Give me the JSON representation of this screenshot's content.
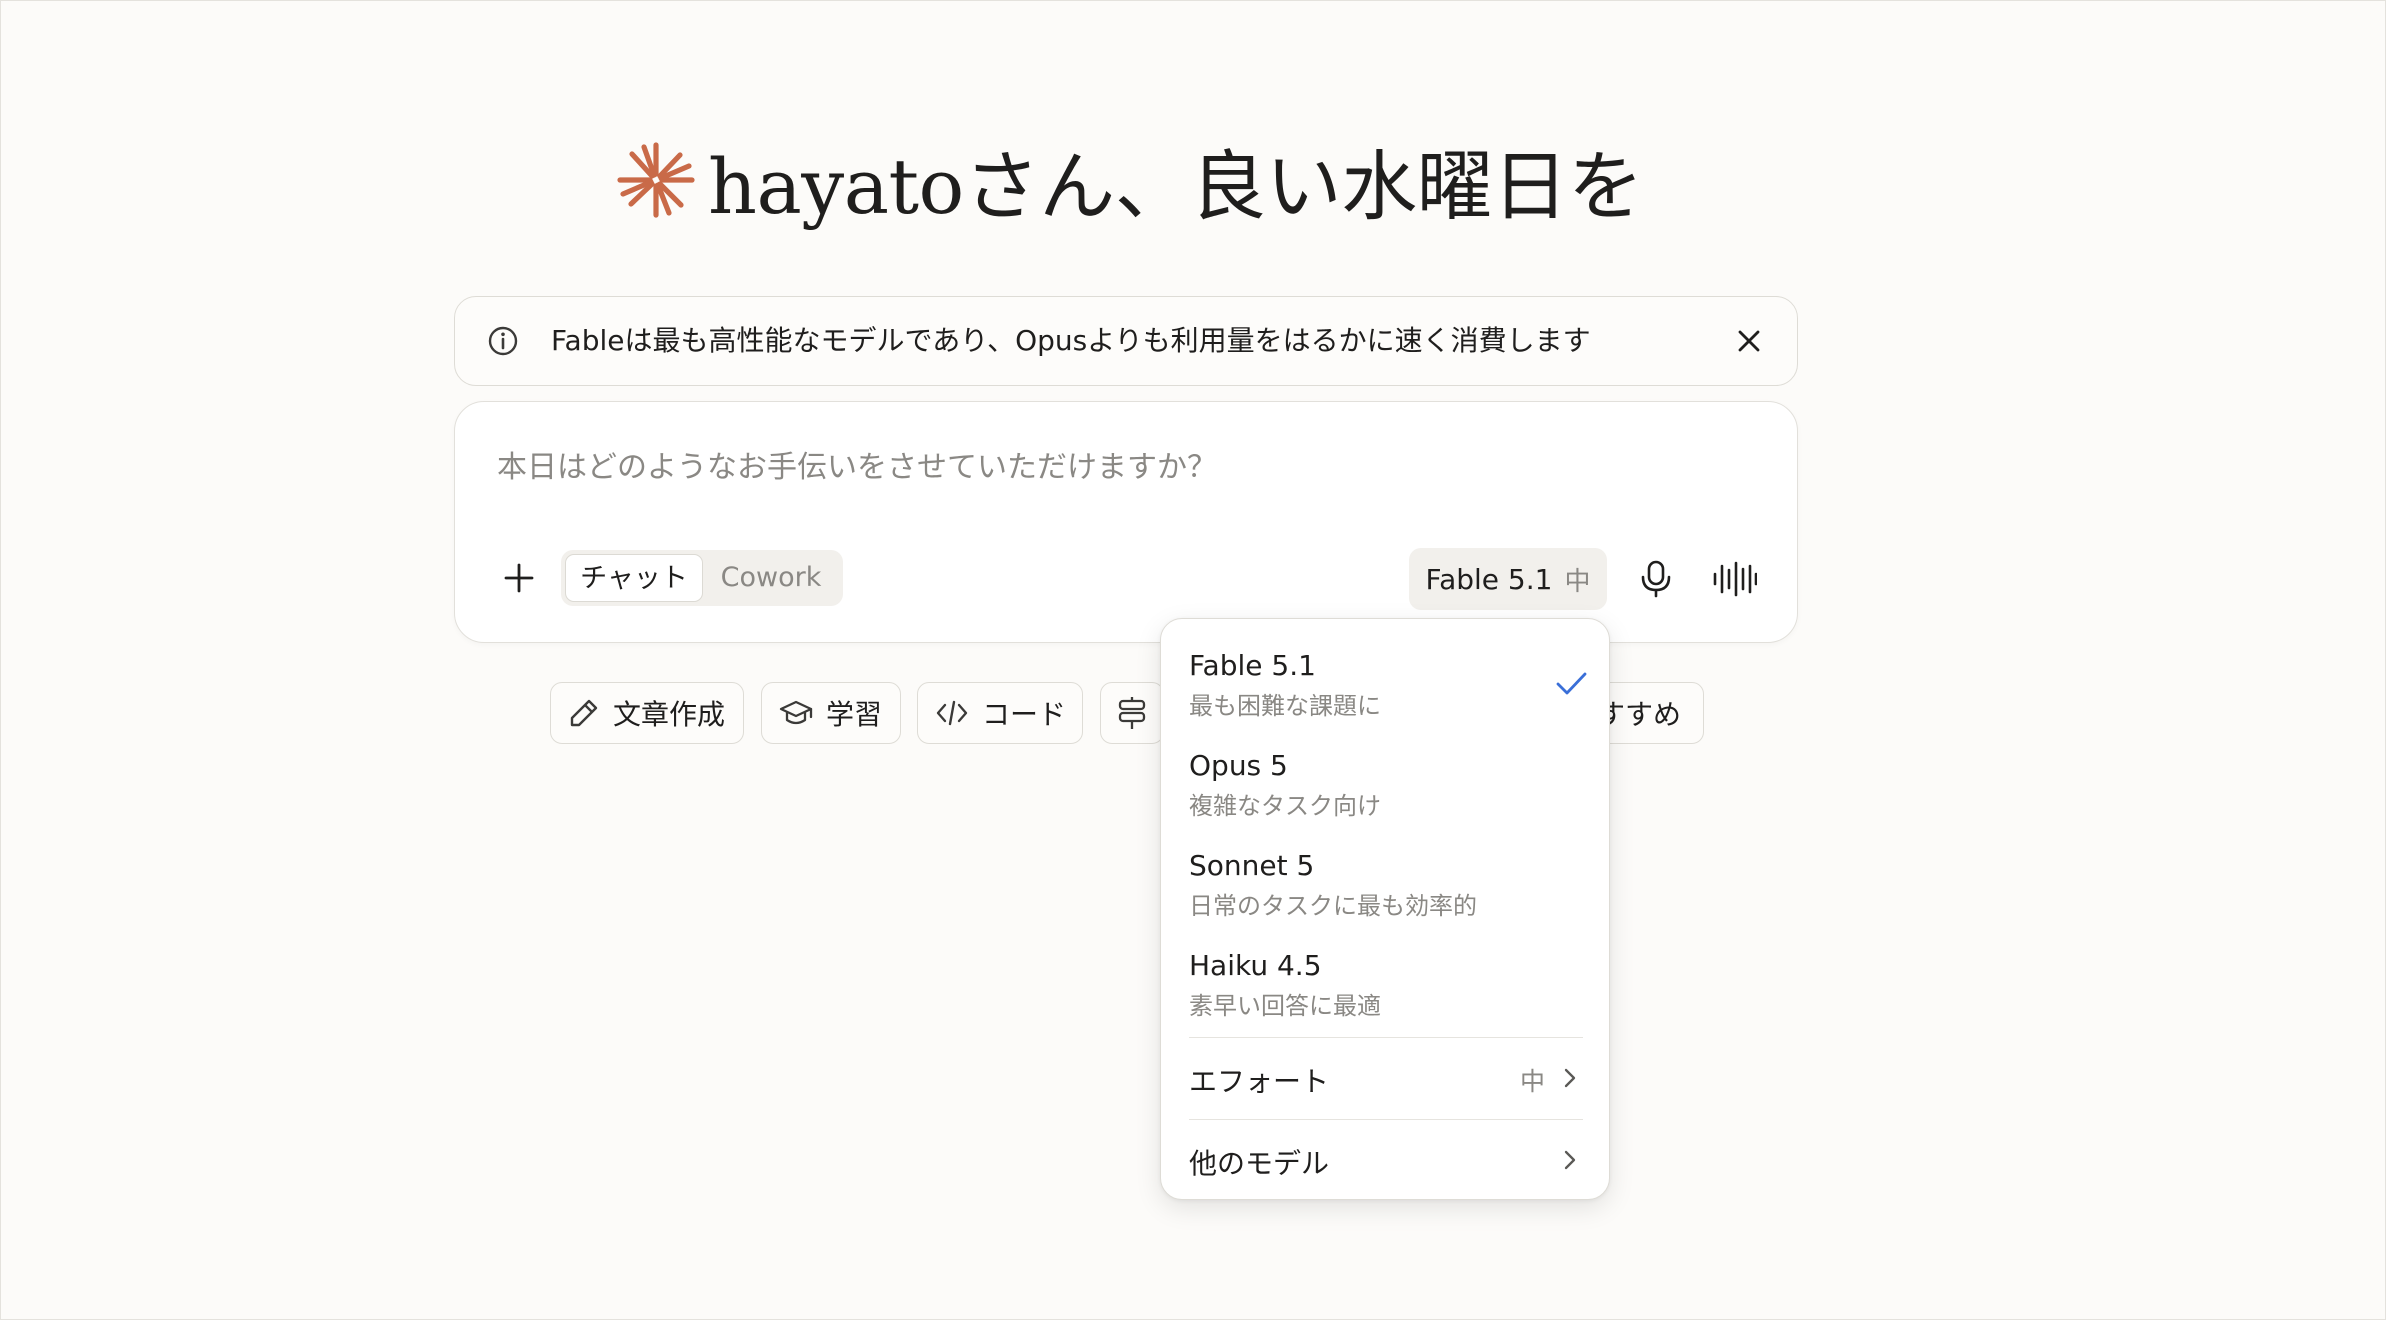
{
  "greeting": {
    "text": "hayatoさん、良い水曜日を",
    "logo_icon": "sparkle-logo",
    "logo_color": "#c96a48"
  },
  "banner": {
    "icon": "info-icon",
    "text": "Fableは最も高性能なモデルであり、Opusよりも利用量をはるかに速く消費します",
    "close_icon": "close-icon"
  },
  "composer": {
    "placeholder": "本日はどのようなお手伝いをさせていただけますか？",
    "add_icon": "plus-icon",
    "modes": {
      "chat": "チャット",
      "cowork": "Cowork",
      "selected": "chat"
    },
    "model_selector": {
      "model": "Fable 5.1",
      "effort": "中"
    },
    "mic_icon": "microphone-icon",
    "voice_icon": "voice-waveform-icon"
  },
  "chips": [
    {
      "label": "文章作成",
      "icon": "pencil-icon"
    },
    {
      "label": "学習",
      "icon": "graduation-cap-icon"
    },
    {
      "label": "コード",
      "icon": "code-icon"
    },
    {
      "label": "",
      "icon": "signpost-icon"
    },
    {
      "label": "すすめ",
      "icon": ""
    }
  ],
  "model_menu": {
    "models": [
      {
        "name": "Fable 5.1",
        "desc": "最も困難な課題に",
        "selected": true
      },
      {
        "name": "Opus 5",
        "desc": "複雑なタスク向け",
        "selected": false
      },
      {
        "name": "Sonnet 5",
        "desc": "日常のタスクに最も効率的",
        "selected": false
      },
      {
        "name": "Haiku 4.5",
        "desc": "素早い回答に最適",
        "selected": false
      }
    ],
    "effort": {
      "label": "エフォート",
      "value": "中"
    },
    "other_models": {
      "label": "他のモデル"
    },
    "check_color": "#3a6fd8"
  }
}
